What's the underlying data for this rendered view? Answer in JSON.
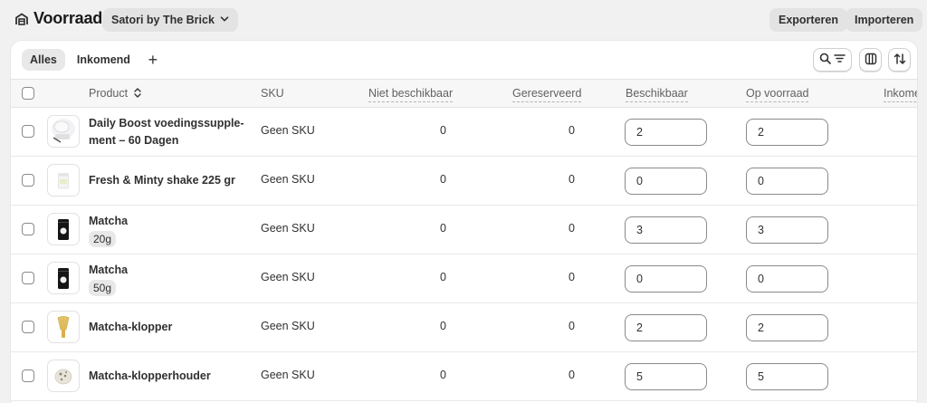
{
  "header": {
    "title": "Voorraad",
    "store": "Satori by The Brick",
    "export_label": "Exporteren",
    "import_label": "Importeren"
  },
  "tabs": [
    {
      "label": "Alles",
      "active": true
    },
    {
      "label": "Inkomend",
      "active": false
    }
  ],
  "add_tab_label": "+",
  "columns": {
    "product": "Product",
    "sku": "SKU",
    "unavailable": "Niet beschikbaar",
    "reserved": "Gereserveerd",
    "available": "Beschikbaar",
    "on_hand": "Op voorraad",
    "incoming": "Inkome"
  },
  "rows": [
    {
      "name": "Daily Boost voedingssupple-\nment – 60 Dagen",
      "variant": "",
      "sku": "Geen SKU",
      "unavailable": "0",
      "reserved": "0",
      "available": "2",
      "on_hand": "2",
      "thumb_icon": "supplement-jar-icon"
    },
    {
      "name": "Fresh & Minty shake 225 gr",
      "variant": "",
      "sku": "Geen SKU",
      "unavailable": "0",
      "reserved": "0",
      "available": "0",
      "on_hand": "0",
      "thumb_icon": "shake-tub-icon"
    },
    {
      "name": "Matcha",
      "variant": "20g",
      "sku": "Geen SKU",
      "unavailable": "0",
      "reserved": "0",
      "available": "3",
      "on_hand": "3",
      "thumb_icon": "matcha-tin-icon"
    },
    {
      "name": "Matcha",
      "variant": "50g",
      "sku": "Geen SKU",
      "unavailable": "0",
      "reserved": "0",
      "available": "0",
      "on_hand": "0",
      "thumb_icon": "matcha-tin-icon"
    },
    {
      "name": "Matcha-klopper",
      "variant": "",
      "sku": "Geen SKU",
      "unavailable": "0",
      "reserved": "0",
      "available": "2",
      "on_hand": "2",
      "thumb_icon": "bamboo-whisk-icon"
    },
    {
      "name": "Matcha-klopperhouder",
      "variant": "",
      "sku": "Geen SKU",
      "unavailable": "0",
      "reserved": "0",
      "available": "5",
      "on_hand": "5",
      "thumb_icon": "whisk-holder-icon"
    }
  ],
  "colors": {
    "page_bg": "#f1f1f1",
    "card_bg": "#ffffff",
    "button_bg": "#e3e3e3",
    "text": "#303030"
  }
}
